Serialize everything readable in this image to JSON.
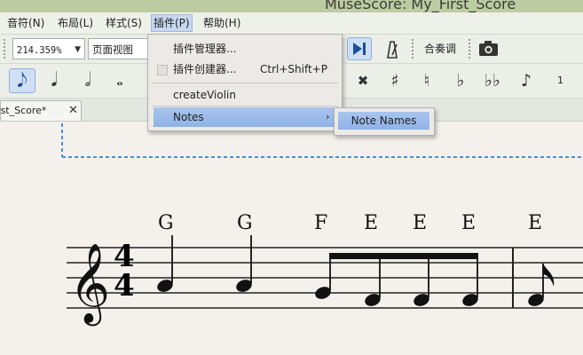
{
  "window": {
    "title": "MuseScore: My_First_Score"
  },
  "menubar": [
    {
      "label": "音符(N)"
    },
    {
      "label": "布局(L)"
    },
    {
      "label": "样式(S)"
    },
    {
      "label": "插件(P)"
    },
    {
      "label": "帮助(H)"
    }
  ],
  "toolbar": {
    "zoom_value": "214.359%",
    "view_mode": "页面视图",
    "concert_pitch_label": "合奏调"
  },
  "note_input": {
    "durations": [
      "eighth-note",
      "quarter-note",
      "half-note",
      "whole-note"
    ],
    "accidentals": [
      "double-flat-icon",
      "sharp",
      "natural",
      "flat",
      "double-flat",
      "tie"
    ],
    "voice_label": "1"
  },
  "tab": {
    "title": "irst_Score*",
    "close": "✕"
  },
  "plugins_menu": {
    "items": [
      {
        "label": "插件管理器...",
        "shortcut": ""
      },
      {
        "label": "插件创建器...",
        "shortcut": "Ctrl+Shift+P"
      },
      {
        "label": "createViolin",
        "shortcut": ""
      },
      {
        "label": "Notes",
        "shortcut": "",
        "submenu_arrow": "›"
      }
    ]
  },
  "notes_submenu": {
    "items": [
      {
        "label": "Note Names"
      }
    ]
  },
  "score": {
    "time_signature": {
      "top": "4",
      "bottom": "4"
    },
    "note_names": [
      "G",
      "G",
      "F",
      "E",
      "E",
      "E",
      "E"
    ]
  }
}
